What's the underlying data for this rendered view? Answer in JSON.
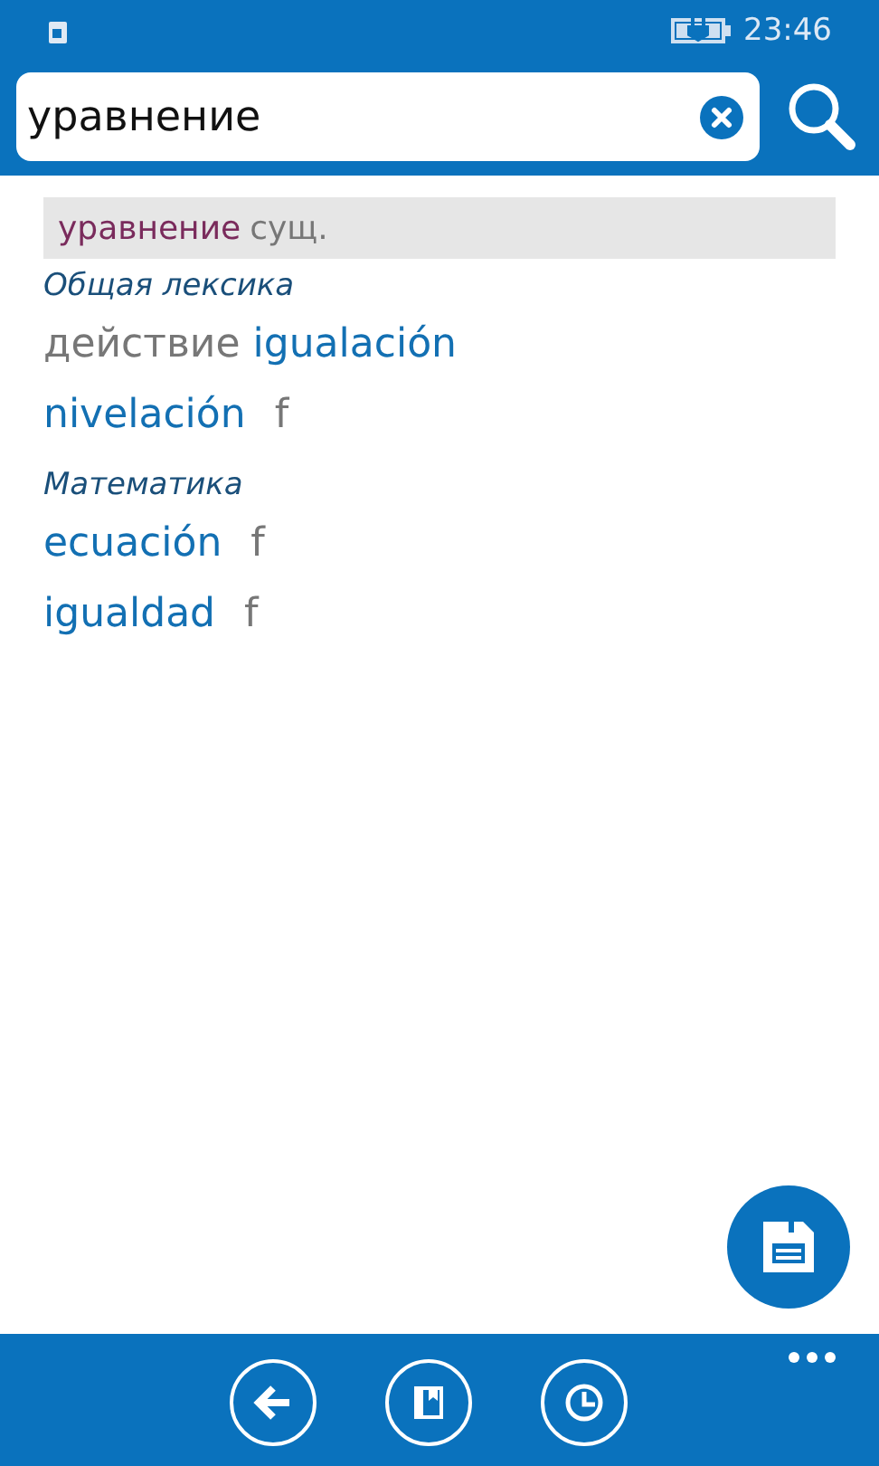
{
  "status_bar": {
    "time": "23:46"
  },
  "search": {
    "value": "уравнение"
  },
  "entry": {
    "headword": "уравнение",
    "pos": "сущ."
  },
  "senses": [
    {
      "domain": "Общая лексика",
      "lines": [
        {
          "parts": [
            {
              "kind": "note",
              "text": "действие"
            },
            {
              "kind": "translation",
              "text": "igualación"
            }
          ]
        },
        {
          "parts": [
            {
              "kind": "translation",
              "text": "nivelación"
            },
            {
              "kind": "gender",
              "text": "f"
            }
          ]
        }
      ]
    },
    {
      "domain": "Математика",
      "lines": [
        {
          "parts": [
            {
              "kind": "translation",
              "text": "ecuación"
            },
            {
              "kind": "gender",
              "text": "f"
            }
          ]
        },
        {
          "parts": [
            {
              "kind": "translation",
              "text": "igualdad"
            },
            {
              "kind": "gender",
              "text": "f"
            }
          ]
        }
      ]
    }
  ]
}
